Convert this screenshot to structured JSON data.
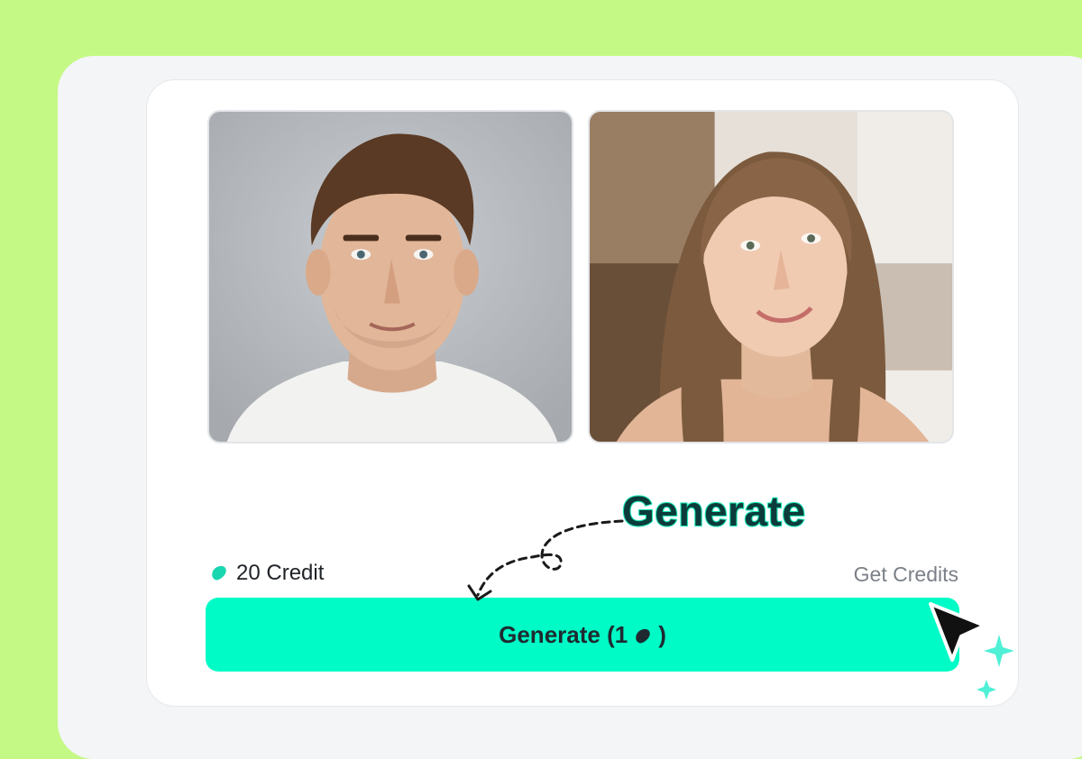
{
  "credits": {
    "balance_label": "20 Credit",
    "get_credits_label": "Get Credits"
  },
  "generate_button": {
    "label_prefix": "Generate (1",
    "label_suffix": ")"
  },
  "annotation": {
    "label": "Generate"
  },
  "colors": {
    "page_background": "#c5f985",
    "accent": "#00fbc6",
    "bean_icon": "#1ad6b0"
  },
  "icons": {
    "credit": "bean-icon",
    "cursor": "cursor-icon",
    "sparkle": "sparkle-icon"
  }
}
